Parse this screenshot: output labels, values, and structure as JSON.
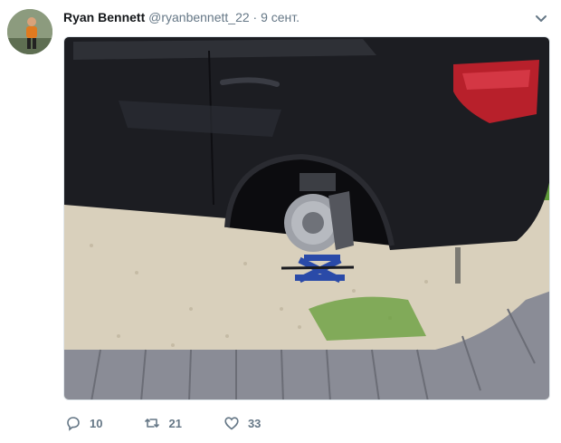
{
  "tweet": {
    "author_name": "Ryan Bennett",
    "handle": "@ryanbennett_22",
    "separator": "·",
    "time": "9 сент.",
    "media_subject": "black SUV with rear wheel removed, brake disc resting on a scissor jack on gravel",
    "actions": {
      "reply": {
        "icon": "reply-icon",
        "count": "10"
      },
      "retweet": {
        "icon": "retweet-icon",
        "count": "21"
      },
      "like": {
        "icon": "heart-icon",
        "count": "33"
      }
    },
    "menu_icon": "chevron-down-icon"
  },
  "colors": {
    "name": "#14171a",
    "secondary": "#657786",
    "car_body": "#1c1d22",
    "gravel": "#d9d0bc",
    "grass": "#5f9a3a",
    "curb": "#8a8c96",
    "jack": "#2a4aa8"
  }
}
